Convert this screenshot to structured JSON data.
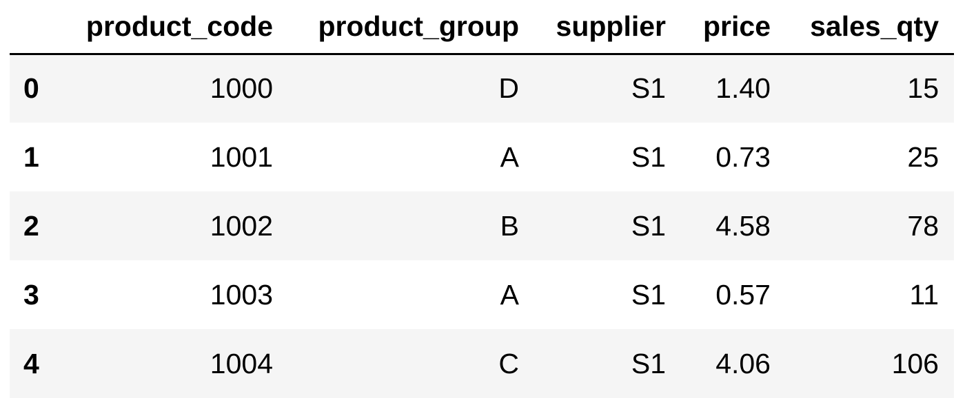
{
  "table": {
    "columns": [
      "",
      "product_code",
      "product_group",
      "supplier",
      "price",
      "sales_qty"
    ],
    "rows": [
      {
        "index": "0",
        "product_code": "1000",
        "product_group": "D",
        "supplier": "S1",
        "price": "1.40",
        "sales_qty": "15"
      },
      {
        "index": "1",
        "product_code": "1001",
        "product_group": "A",
        "supplier": "S1",
        "price": "0.73",
        "sales_qty": "25"
      },
      {
        "index": "2",
        "product_code": "1002",
        "product_group": "B",
        "supplier": "S1",
        "price": "4.58",
        "sales_qty": "78"
      },
      {
        "index": "3",
        "product_code": "1003",
        "product_group": "A",
        "supplier": "S1",
        "price": "0.57",
        "sales_qty": "11"
      },
      {
        "index": "4",
        "product_code": "1004",
        "product_group": "C",
        "supplier": "S1",
        "price": "4.06",
        "sales_qty": "106"
      }
    ]
  }
}
